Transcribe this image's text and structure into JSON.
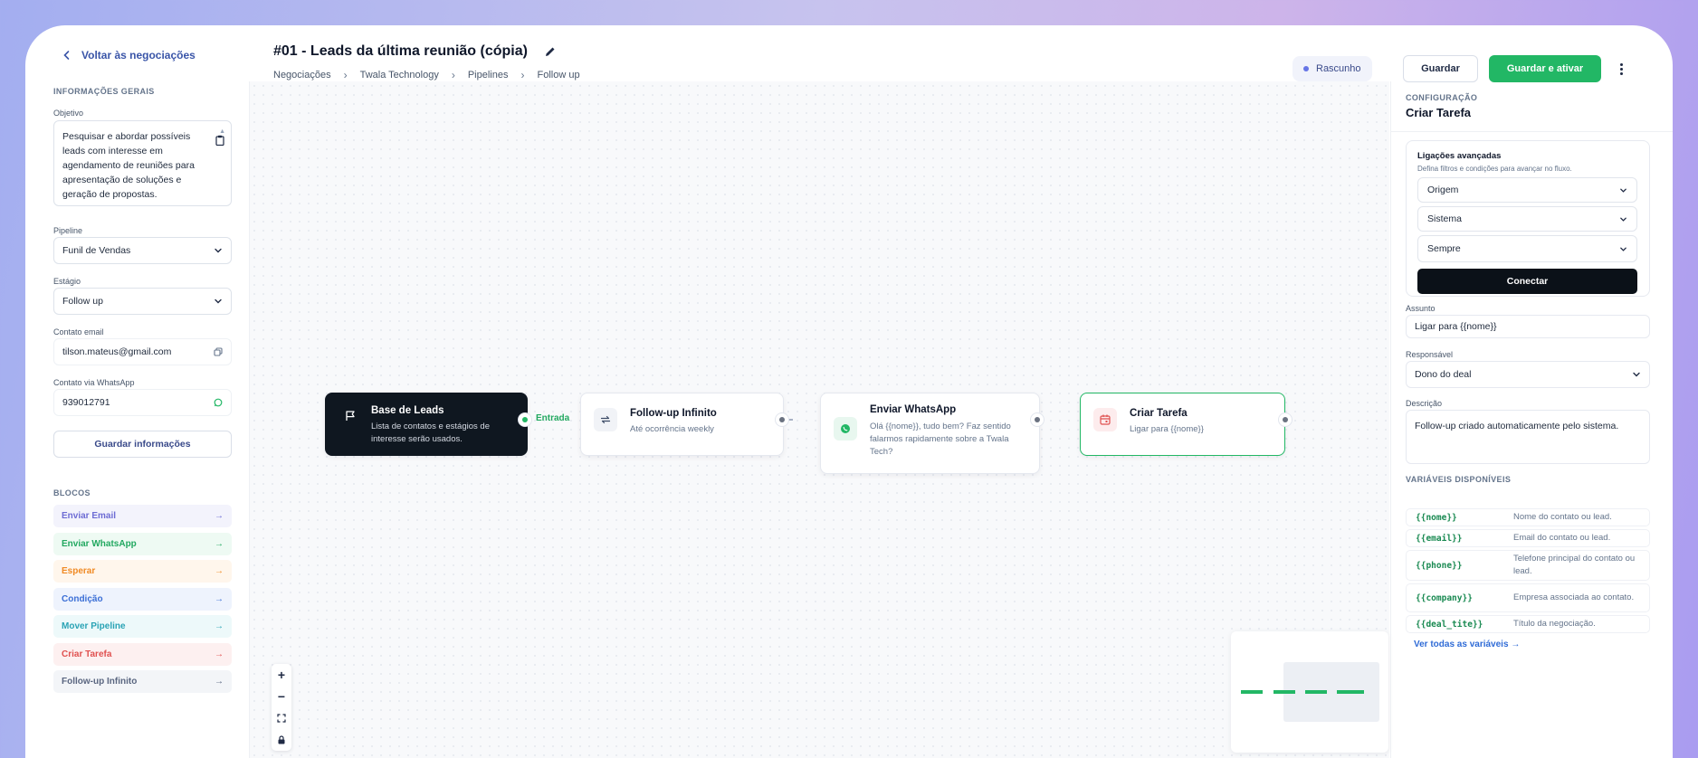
{
  "header": {
    "back_label": "Voltar às negociações",
    "title": "#01 - Leads da última reunião (cópia)",
    "breadcrumbs": [
      "Negociações",
      "Twala Technology",
      "Pipelines",
      "Follow up"
    ],
    "status": "Rascunho",
    "save_label": "Guardar",
    "activate_label": "Guardar e ativar"
  },
  "left": {
    "section_title": "INFORMAÇÕES GERAIS",
    "objective_label": "Objetivo",
    "objective_value": "Pesquisar e abordar possíveis leads com interesse em agendamento de reuniões para apresentação de soluções e geração de propostas.",
    "pipeline_label": "Pipeline",
    "pipeline_value": "Funil de Vendas",
    "stage_label": "Estágio",
    "stage_value": "Follow up",
    "email_label": "Contato email",
    "email_value": "tilson.mateus@gmail.com",
    "whatsapp_label": "Contato via WhatsApp",
    "whatsapp_value": "939012791",
    "save_info_label": "Guardar informações",
    "blocks_title": "BLOCOS",
    "blocks": [
      {
        "label": "Enviar Email",
        "color": "#6d6cd4",
        "bg": "#f3f3fc"
      },
      {
        "label": "Enviar WhatsApp",
        "color": "#22a860",
        "bg": "#eefaf3"
      },
      {
        "label": "Esperar",
        "color": "#f08a24",
        "bg": "#fff6ec"
      },
      {
        "label": "Condição",
        "color": "#3b6fd6",
        "bg": "#eef3fd"
      },
      {
        "label": "Mover Pipeline",
        "color": "#2aa3b5",
        "bg": "#edf9fa"
      },
      {
        "label": "Criar Tarefa",
        "color": "#e0504f",
        "bg": "#fdf0f0"
      },
      {
        "label": "Follow-up Infinito",
        "color": "#5a6680",
        "bg": "#f3f5f8"
      }
    ]
  },
  "canvas": {
    "nodes": [
      {
        "title": "Base de Leads",
        "sub": "Lista de contatos e estágios de interesse serão usados."
      },
      {
        "title": "Follow-up Infinito",
        "sub": "Até ocorrência weekly"
      },
      {
        "title": "Enviar WhatsApp",
        "sub": "Olá {{nome}}, tudo bem? Faz sentido falarmos rapidamente sobre a Twala Tech?"
      },
      {
        "title": "Criar Tarefa",
        "sub": "Ligar para {{nome}}"
      }
    ],
    "entry_label": "Entrada"
  },
  "right": {
    "section_title": "CONFIGURAÇÃO",
    "title": "Criar Tarefa",
    "advanced_title": "Ligações avançadas",
    "advanced_sub": "Defina filtros e condições para avançar no fluxo.",
    "origin": "Origem",
    "system": "Sistema",
    "always": "Sempre",
    "connect_label": "Conectar",
    "subject_label": "Assunto",
    "subject_value": "Ligar para {{nome}}",
    "owner_label": "Responsável",
    "owner_value": "Dono do deal",
    "desc_label": "Descrição",
    "desc_value": "Follow-up criado automaticamente pelo sistema.",
    "vars_title": "VARIÁVEIS DISPONÍVEIS",
    "vars": [
      {
        "name": "{{nome}}",
        "desc": "Nome do contato ou lead."
      },
      {
        "name": "{{email}}",
        "desc": "Email do contato ou lead."
      },
      {
        "name": "{{phone}}",
        "desc": "Telefone principal do contato ou lead."
      },
      {
        "name": "{{company}}",
        "desc": "Empresa associada ao contato."
      },
      {
        "name": "{{deal_tite}}",
        "desc": "Título da negociação."
      }
    ],
    "see_all": "Ver todas as variáveis"
  }
}
